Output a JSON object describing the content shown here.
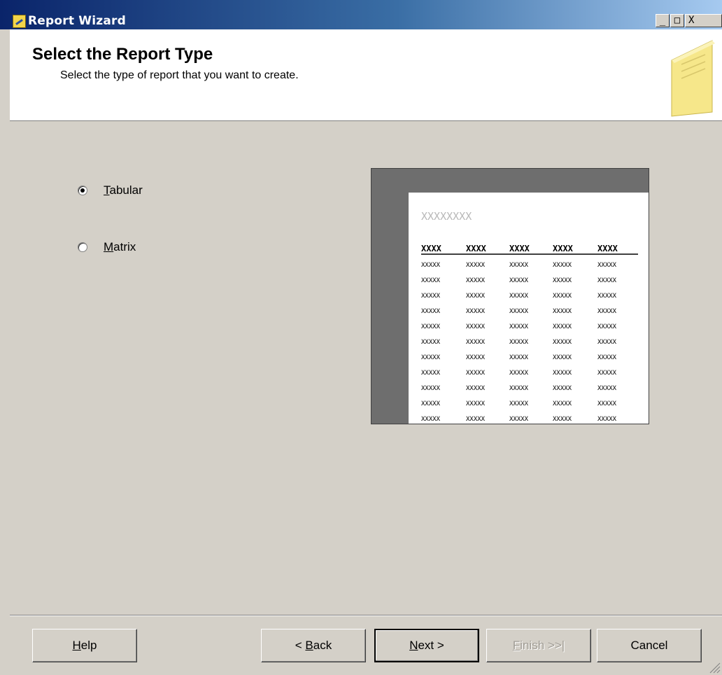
{
  "window": {
    "title": "Report Wizard",
    "controls": {
      "minimize": "_",
      "maximize": "□",
      "close": "X"
    }
  },
  "header": {
    "title": "Select the Report Type",
    "subtitle": "Select the type of report that you want to create."
  },
  "report_types": {
    "selected": "Tabular",
    "options": [
      {
        "label": "Tabular",
        "mnemonic": "T",
        "rest": "abular",
        "checked": true
      },
      {
        "label": "Matrix",
        "mnemonic": "M",
        "rest": "atrix",
        "checked": false
      }
    ]
  },
  "preview": {
    "title_placeholder": "XXXXXXXX",
    "header_cell": "XXXX",
    "body_cell": "XXXXX",
    "columns": 5,
    "rows": 11
  },
  "buttons": {
    "help": {
      "mnemonic": "H",
      "rest": "elp"
    },
    "back": {
      "prefix": "< ",
      "mnemonic": "B",
      "rest": "ack"
    },
    "next": {
      "mnemonic": "N",
      "rest": "ext >"
    },
    "finish": {
      "mnemonic": "F",
      "rest": "inish >>|",
      "enabled": false
    },
    "cancel": {
      "label": "Cancel"
    }
  },
  "icons": {
    "app": "report-wizard-icon",
    "header": "notepad-icon",
    "resize": "size-grip-icon"
  }
}
